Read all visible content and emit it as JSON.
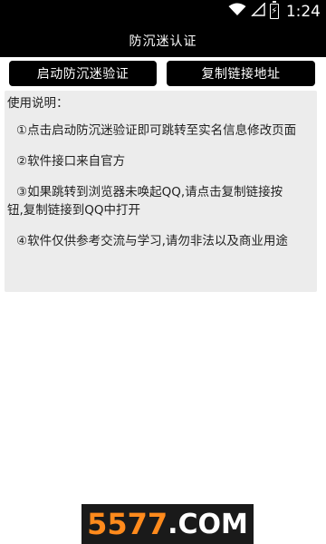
{
  "status_bar": {
    "time": "1:24",
    "wifi_icon": "wifi-icon",
    "signal_icon": "signal-icon",
    "battery_icon": "battery-charging-icon"
  },
  "title_bar": {
    "title": "防沉迷认证"
  },
  "buttons": {
    "start_label": "启动防沉迷验证",
    "copy_label": "复制链接地址"
  },
  "instructions": {
    "heading": "使用说明：",
    "items": [
      "①点击启动防沉迷验证即可跳转至实名信息修改页面",
      "②软件接口来自官方",
      "③如果跳转到浏览器未唤起QQ,请点击复制链接按",
      "钮,复制链接到QQ中打开",
      "④软件仅供参考交流与学习,请勿非法以及商业用途"
    ]
  },
  "watermark": {
    "number": "5577",
    "suffix": ".COM"
  },
  "colors": {
    "bar": "#000000",
    "panel": "#ececec",
    "watermark_accent": "#ff8a1c"
  }
}
